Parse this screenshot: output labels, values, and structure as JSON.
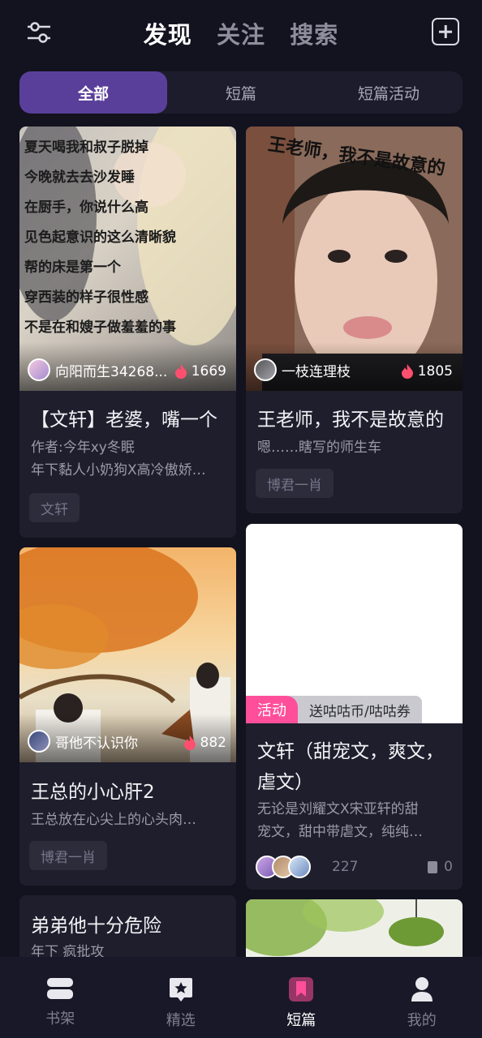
{
  "header": {
    "tabs": [
      "发现",
      "关注",
      "搜索"
    ],
    "active_tab": 0
  },
  "segments": [
    "全部",
    "短篇",
    "短篇活动"
  ],
  "cards": {
    "c1": {
      "author": "向阳而生34268...",
      "heat": "1669",
      "title": "【文轩】老婆，嘴一个",
      "desc": [
        "作者:今年xy冬眠",
        "年下黏人小奶狗X高冷傲娇…"
      ],
      "tag": "文轩",
      "cover_text": [
        "夏天喝我和叔子脱掉",
        "今晚就去去沙发睡",
        "在厨手，你说什么高",
        "见色起意识的这么清晰貌",
        "帮的床是第一个",
        "穿西装的样子很性感",
        "不是在和嫂子做羞羞的事"
      ]
    },
    "c2": {
      "author": "一枝连理枝",
      "heat": "1805",
      "title": "王老师，我不是故意的",
      "desc": [
        "嗯……瞎写的师生车"
      ],
      "tag": "博君一肖",
      "cover_caption": "王老师，我不是故意的"
    },
    "c3": {
      "author": "哥他不认识你",
      "heat": "882",
      "title": "王总的小心肝2",
      "desc": [
        "王总放在心尖上的心头肉…"
      ],
      "tag": "博君一肖"
    },
    "c4": {
      "badge": "活动",
      "badge_sub": "送咕咕币/咕咕券",
      "title_lines": [
        "文轩（甜宠文，爽文，",
        "虐文）"
      ],
      "desc": [
        "无论是刘耀文X宋亚轩的甜",
        "宠文，甜中带虐文，纯纯…"
      ],
      "participants": "227",
      "works": "0"
    },
    "c5": {
      "title": "弟弟他十分危险",
      "desc": [
        "年下 疯批攻"
      ]
    }
  },
  "bottom_nav": [
    "书架",
    "精选",
    "短篇",
    "我的"
  ],
  "colors": {
    "background": "#13121f",
    "accent": "#5a3f9a",
    "hot_badge": "#ff4f9a",
    "heat_flame": "#ff4f6e"
  }
}
